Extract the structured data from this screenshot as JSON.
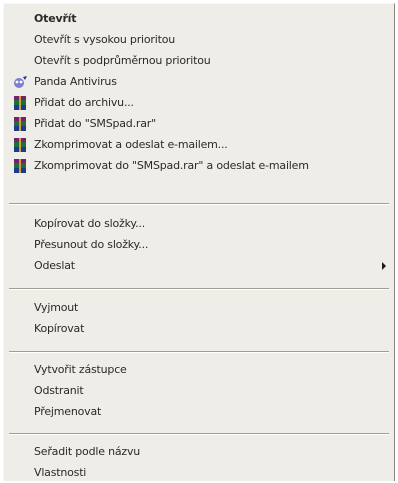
{
  "menu": {
    "items": [
      {
        "label": "Otevřít"
      },
      {
        "label": "Otevřít s vysokou prioritou"
      },
      {
        "label": "Otevřít s podprůměrnou prioritou"
      },
      {
        "label": "Panda Antivirus",
        "icon": "panda-antivirus-icon"
      },
      {
        "label": "Přidat do archivu...",
        "icon": "winrar-archive-icon"
      },
      {
        "label": "Přidat do \"SMSpad.rar\"",
        "icon": "winrar-archive-icon"
      },
      {
        "label": "Zkomprimovat a odeslat e-mailem...",
        "icon": "winrar-archive-icon"
      },
      {
        "label": "Zkomprimovat do \"SMSpad.rar\" a odeslat e-mailem",
        "icon": "winrar-archive-icon"
      },
      {
        "label": "Kopírovat do složky..."
      },
      {
        "label": "Přesunout do složky..."
      },
      {
        "label": "Odeslat"
      },
      {
        "label": "Vyjmout"
      },
      {
        "label": "Kopírovat"
      },
      {
        "label": "Vytvořit zástupce"
      },
      {
        "label": "Odstranit"
      },
      {
        "label": "Přejmenovat"
      },
      {
        "label": "Seřadit podle názvu"
      },
      {
        "label": "Vlastnosti"
      }
    ]
  },
  "colors": {
    "menu_background": "#efede7",
    "separator": "#a19d95",
    "text": "#2a2a2a"
  }
}
